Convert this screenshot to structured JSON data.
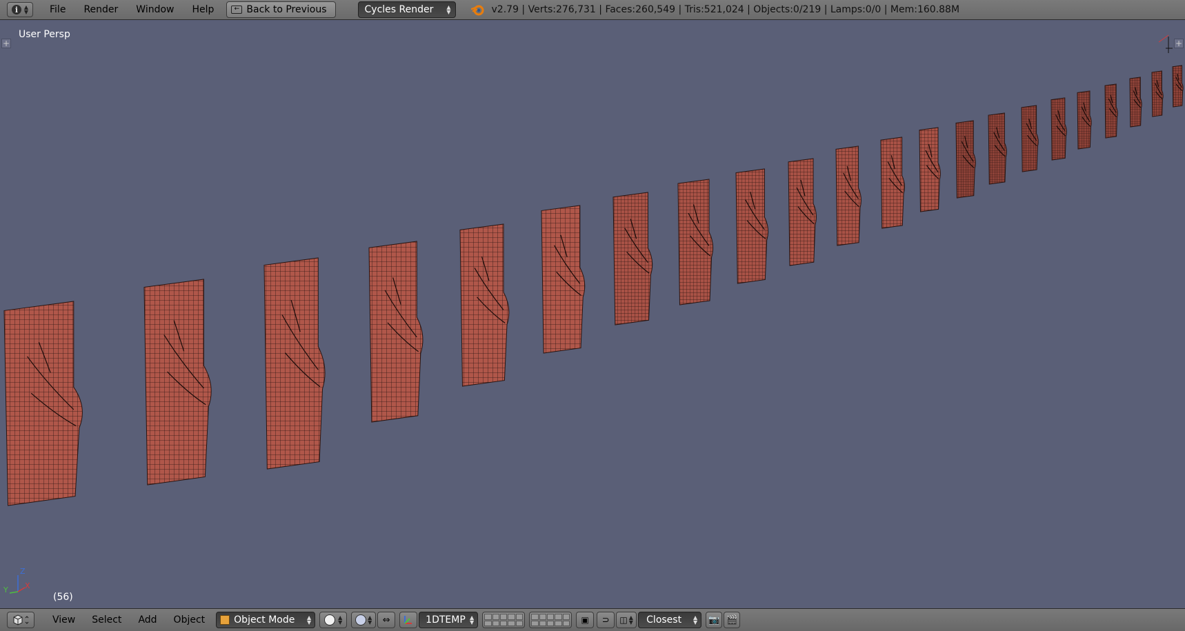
{
  "topbar": {
    "menus": [
      "File",
      "Render",
      "Window",
      "Help"
    ],
    "back_label": "Back to Previous",
    "render_engine": "Cycles Render",
    "stats": "v2.79 | Verts:276,731 | Faces:260,549 | Tris:521,024 | Objects:0/219 | Lamps:0/0 | Mem:160.88M"
  },
  "viewport": {
    "view_name": "User Persp",
    "frame": "(56)",
    "axis_labels": {
      "z": "Z",
      "y": "Y",
      "x": "X"
    }
  },
  "bottombar": {
    "menus": [
      "View",
      "Select",
      "Add",
      "Object"
    ],
    "mode": "Object Mode",
    "orientation": "1DTEMP",
    "snap_target": "Closest"
  },
  "colors": {
    "viewport_bg": "#5a5f77",
    "mesh_fill": "#b0574a",
    "wire": "#2a1512"
  }
}
